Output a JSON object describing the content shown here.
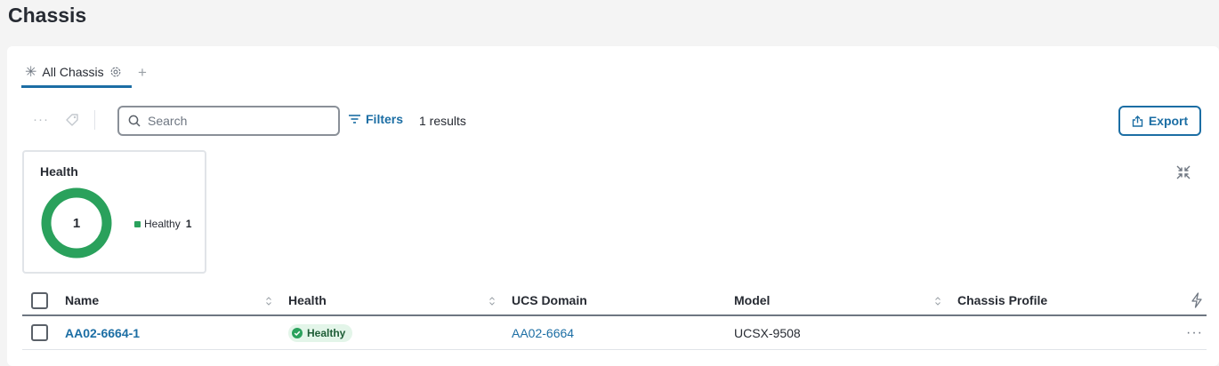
{
  "page": {
    "title": "Chassis"
  },
  "tabs": [
    {
      "label": "All Chassis",
      "active": true
    }
  ],
  "toolbar": {
    "search_placeholder": "Search",
    "filters_label": "Filters",
    "results_text": "1 results",
    "export_label": "Export"
  },
  "health_widget": {
    "title": "Health",
    "total": "1",
    "legend": [
      {
        "label": "Healthy",
        "count": "1",
        "color": "#2aa15c"
      }
    ]
  },
  "table": {
    "columns": [
      "Name",
      "Health",
      "UCS Domain",
      "Model",
      "Chassis Profile"
    ],
    "rows": [
      {
        "name": "AA02-6664-1",
        "health": "Healthy",
        "ucs_domain": "AA02-6664",
        "model": "UCSX-9508",
        "chassis_profile": ""
      }
    ]
  },
  "colors": {
    "accent": "#1c6ea4",
    "healthy": "#2aa15c"
  }
}
